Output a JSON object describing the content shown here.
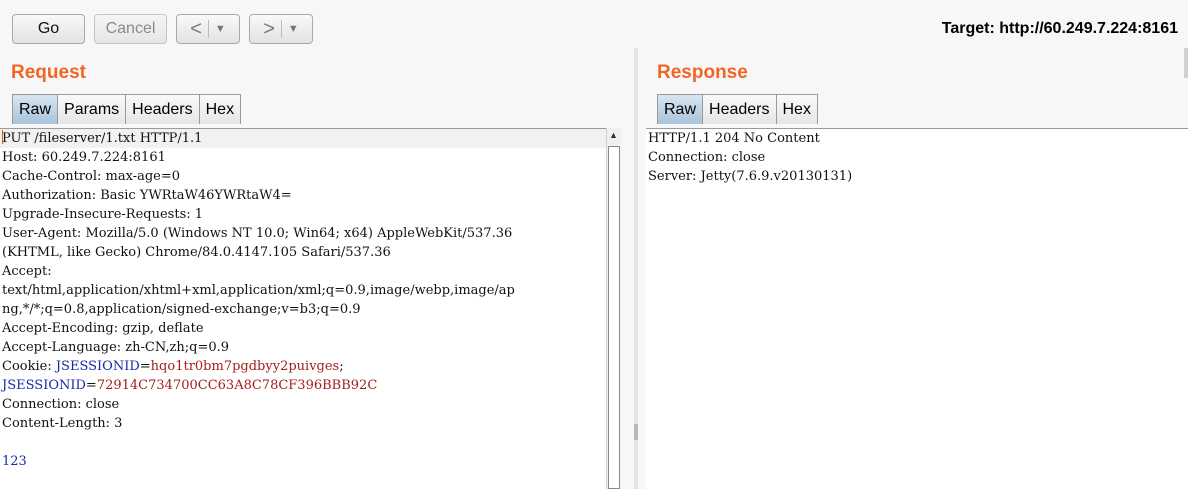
{
  "toolbar": {
    "go_label": "Go",
    "cancel_label": "Cancel",
    "back_label": "<",
    "forward_label": ">",
    "dropdown_glyph": "▼",
    "target_label": "Target: http://60.249.7.224:8161"
  },
  "request": {
    "title": "Request",
    "tabs": [
      {
        "label": "Raw",
        "active": true
      },
      {
        "label": "Params",
        "active": false
      },
      {
        "label": "Headers",
        "active": false
      },
      {
        "label": "Hex",
        "active": false
      }
    ],
    "lines": [
      "PUT /fileserver/1.txt HTTP/1.1",
      "Host: 60.249.7.224:8161",
      "Cache-Control: max-age=0",
      "Authorization: Basic YWRtaW46YWRtaW4=",
      "Upgrade-Insecure-Requests: 1",
      "User-Agent: Mozilla/5.0 (Windows NT 10.0; Win64; x64) AppleWebKit/537.36",
      "(KHTML, like Gecko) Chrome/84.0.4147.105 Safari/537.36",
      "Accept:",
      "text/html,application/xhtml+xml,application/xml;q=0.9,image/webp,image/ap",
      "ng,*/*;q=0.8,application/signed-exchange;v=b3;q=0.9",
      "Accept-Encoding: gzip, deflate",
      "Accept-Language: zh-CN,zh;q=0.9",
      "Connection: close",
      "Content-Length: 3",
      "",
      "123"
    ],
    "cookie_prefix": "Cookie: ",
    "cookie1_key": "JSESSIONID",
    "cookie1_val": "hqo1tr0bm7pgdbyy2puivges",
    "cookie2_key": "JSESSIONID",
    "cookie2_val": "72914C734700CC63A8C78CF396BBB92C"
  },
  "response": {
    "title": "Response",
    "tabs": [
      {
        "label": "Raw",
        "active": true
      },
      {
        "label": "Headers",
        "active": false
      },
      {
        "label": "Hex",
        "active": false
      }
    ],
    "lines": [
      "HTTP/1.1 204 No Content",
      "Connection: close",
      "Server: Jetty(7.6.9.v20130131)"
    ]
  },
  "colors": {
    "accent": "#f26522",
    "cookie_key": "#1b2aa8",
    "cookie_value": "#a3201b"
  }
}
